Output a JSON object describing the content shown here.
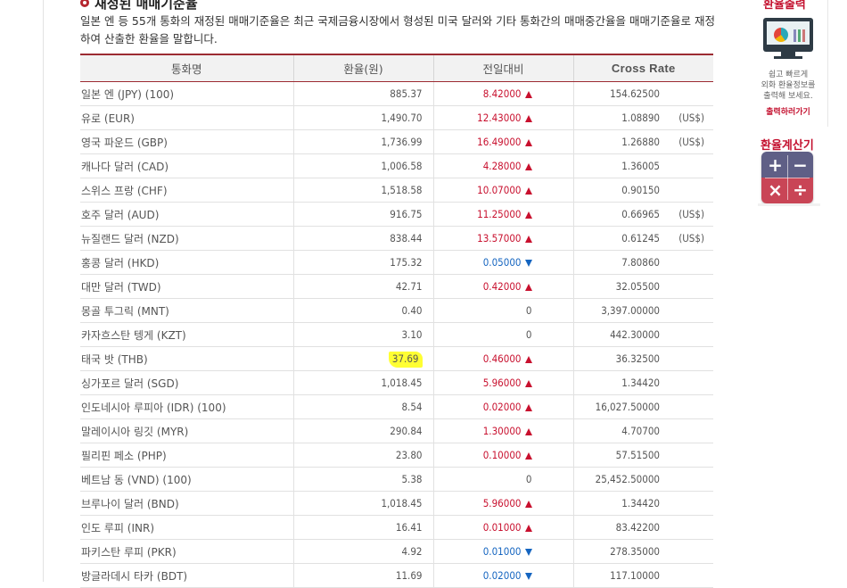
{
  "section": {
    "title": "재정된 매매기준율",
    "description": "일본 엔 등 55개 통화의 재정된 매매기준율은 최근 국제금융시장에서 형성된 미국 달러와 기타 통화간의 매매중간율을 매매기준율로 재정하여 산출한 환율을 말합니다."
  },
  "table": {
    "headers": [
      "통화명",
      "환율(원)",
      "전일대비",
      "Cross Rate"
    ],
    "rows": [
      {
        "name": "일본 엔 (JPY) (100)",
        "rate": "885.37",
        "change": "8.42000",
        "dir": "up",
        "cross": "154.62500",
        "unit": ""
      },
      {
        "name": "유로 (EUR)",
        "rate": "1,490.70",
        "change": "12.43000",
        "dir": "up",
        "cross": "1.08890",
        "unit": "(US$)"
      },
      {
        "name": "영국 파운드 (GBP)",
        "rate": "1,736.99",
        "change": "16.49000",
        "dir": "up",
        "cross": "1.26880",
        "unit": "(US$)"
      },
      {
        "name": "캐나다 달러 (CAD)",
        "rate": "1,006.58",
        "change": "4.28000",
        "dir": "up",
        "cross": "1.36005",
        "unit": ""
      },
      {
        "name": "스위스 프랑 (CHF)",
        "rate": "1,518.58",
        "change": "10.07000",
        "dir": "up",
        "cross": "0.90150",
        "unit": ""
      },
      {
        "name": "호주 달러 (AUD)",
        "rate": "916.75",
        "change": "11.25000",
        "dir": "up",
        "cross": "0.66965",
        "unit": "(US$)"
      },
      {
        "name": "뉴질랜드 달러 (NZD)",
        "rate": "838.44",
        "change": "13.57000",
        "dir": "up",
        "cross": "0.61245",
        "unit": "(US$)"
      },
      {
        "name": "홍콩 달러 (HKD)",
        "rate": "175.32",
        "change": "0.05000",
        "dir": "down",
        "cross": "7.80860",
        "unit": ""
      },
      {
        "name": "대만 달러 (TWD)",
        "rate": "42.71",
        "change": "0.42000",
        "dir": "up",
        "cross": "32.05500",
        "unit": ""
      },
      {
        "name": "몽골 투그릭 (MNT)",
        "rate": "0.40",
        "change": "0",
        "dir": "same",
        "cross": "3,397.00000",
        "unit": ""
      },
      {
        "name": "카자흐스탄 텡게 (KZT)",
        "rate": "3.10",
        "change": "0",
        "dir": "same",
        "cross": "442.30000",
        "unit": ""
      },
      {
        "name": "태국 밧 (THB)",
        "rate": "37.69",
        "change": "0.46000",
        "dir": "up",
        "cross": "36.32500",
        "unit": "",
        "highlight": true
      },
      {
        "name": "싱가포르 달러 (SGD)",
        "rate": "1,018.45",
        "change": "5.96000",
        "dir": "up",
        "cross": "1.34420",
        "unit": ""
      },
      {
        "name": "인도네시아 루피아 (IDR) (100)",
        "rate": "8.54",
        "change": "0.02000",
        "dir": "up",
        "cross": "16,027.50000",
        "unit": ""
      },
      {
        "name": "말레이시아 링깃 (MYR)",
        "rate": "290.84",
        "change": "1.30000",
        "dir": "up",
        "cross": "4.70700",
        "unit": ""
      },
      {
        "name": "필리핀 페소 (PHP)",
        "rate": "23.80",
        "change": "0.10000",
        "dir": "up",
        "cross": "57.51500",
        "unit": ""
      },
      {
        "name": "베트남 동 (VND) (100)",
        "rate": "5.38",
        "change": "0",
        "dir": "same",
        "cross": "25,452.50000",
        "unit": ""
      },
      {
        "name": "브루나이 달러 (BND)",
        "rate": "1,018.45",
        "change": "5.96000",
        "dir": "up",
        "cross": "1.34420",
        "unit": ""
      },
      {
        "name": "인도 루피 (INR)",
        "rate": "16.41",
        "change": "0.01000",
        "dir": "up",
        "cross": "83.42200",
        "unit": ""
      },
      {
        "name": "파키스탄 루피 (PKR)",
        "rate": "4.92",
        "change": "0.01000",
        "dir": "down",
        "cross": "278.35000",
        "unit": ""
      },
      {
        "name": "방글라데시 타카 (BDT)",
        "rate": "11.69",
        "change": "0.02000",
        "dir": "down",
        "cross": "117.10000",
        "unit": ""
      }
    ]
  },
  "widgets": {
    "print": {
      "title": "환율출력",
      "text_lines": [
        "쉽고 빠르게",
        "외화 환율정보를",
        "출력해 보세요."
      ],
      "link": "출력하러가기",
      "icon": "monitor-print-icon"
    },
    "calculator": {
      "title": "환율계산기",
      "keys": [
        "+",
        "−",
        "×",
        "÷"
      ],
      "icon": "calculator-icon"
    }
  },
  "colors": {
    "accent": "#c41230",
    "up": "#c8102e",
    "down": "#1565c0",
    "highlight": "#ffff33",
    "header_border": "#9c2b32"
  }
}
